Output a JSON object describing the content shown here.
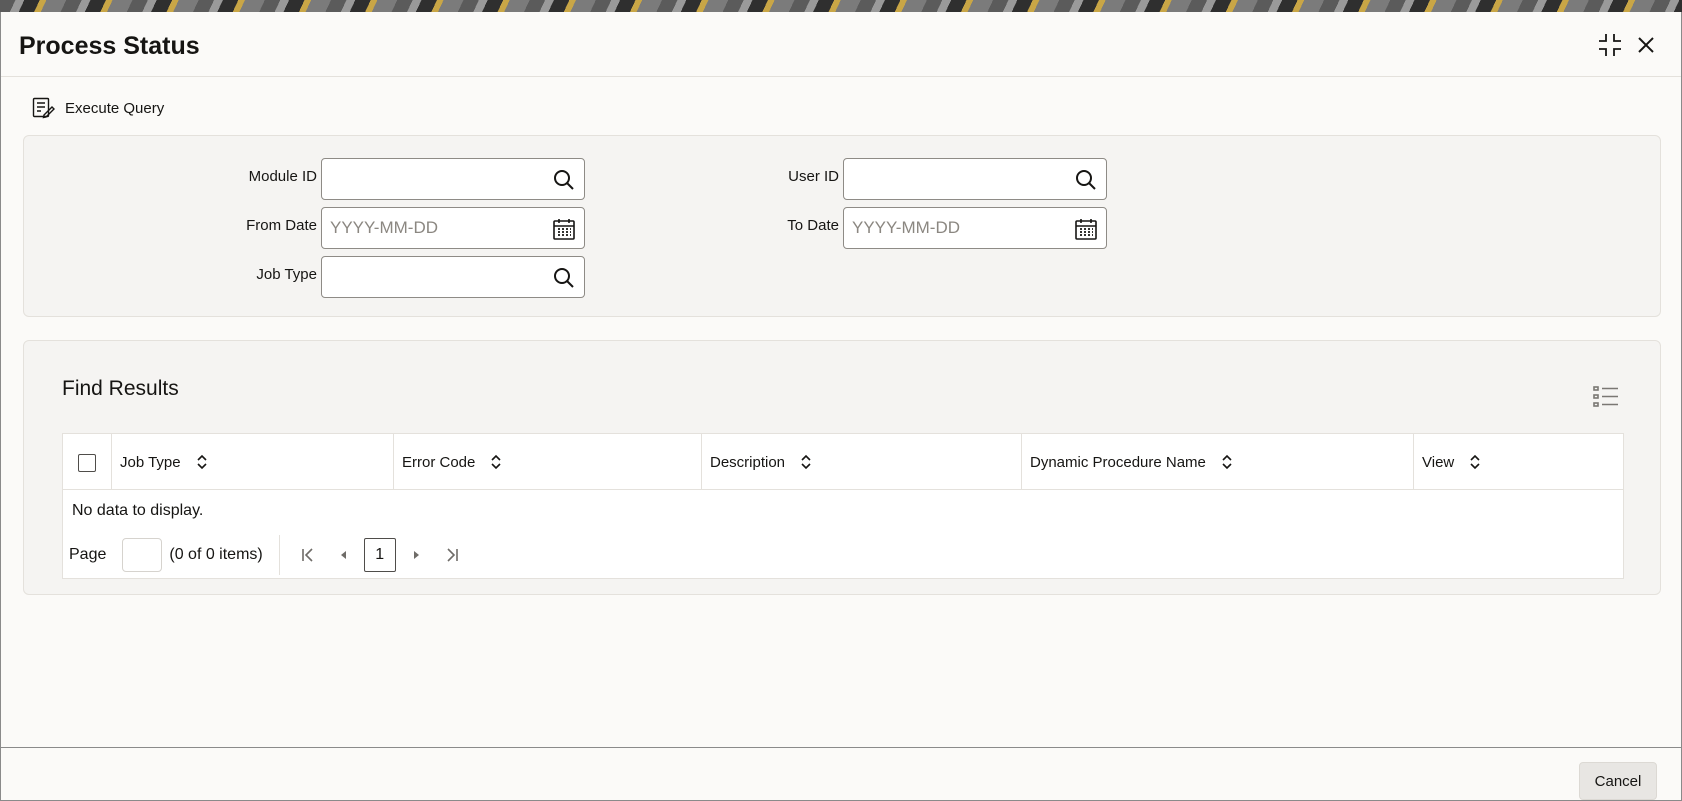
{
  "window": {
    "title": "Process Status"
  },
  "toolbar": {
    "execute_query_label": "Execute Query"
  },
  "criteria": {
    "module_id": {
      "label": "Module ID",
      "value": ""
    },
    "user_id": {
      "label": "User ID",
      "value": ""
    },
    "from_date": {
      "label": "From Date",
      "placeholder": "YYYY-MM-DD",
      "value": ""
    },
    "to_date": {
      "label": "To Date",
      "placeholder": "YYYY-MM-DD",
      "value": ""
    },
    "job_type": {
      "label": "Job Type",
      "value": ""
    }
  },
  "results": {
    "title": "Find Results",
    "columns": [
      "Job Type",
      "Error Code",
      "Description",
      "Dynamic Procedure Name",
      "View"
    ],
    "empty_message": "No data to display.",
    "pager": {
      "page_label": "Page",
      "info": "(0 of 0 items)",
      "current_page": "1"
    }
  },
  "footer": {
    "cancel_label": "Cancel"
  },
  "icons": {
    "maximize": "maximize-icon",
    "close": "close-icon",
    "execute": "execute-query-icon",
    "search": "search-icon",
    "calendar": "calendar-icon",
    "list": "list-view-icon",
    "sort": "sort-icon",
    "first": "first-page-icon",
    "prev": "prev-page-icon",
    "next": "next-page-icon",
    "last": "last-page-icon"
  }
}
